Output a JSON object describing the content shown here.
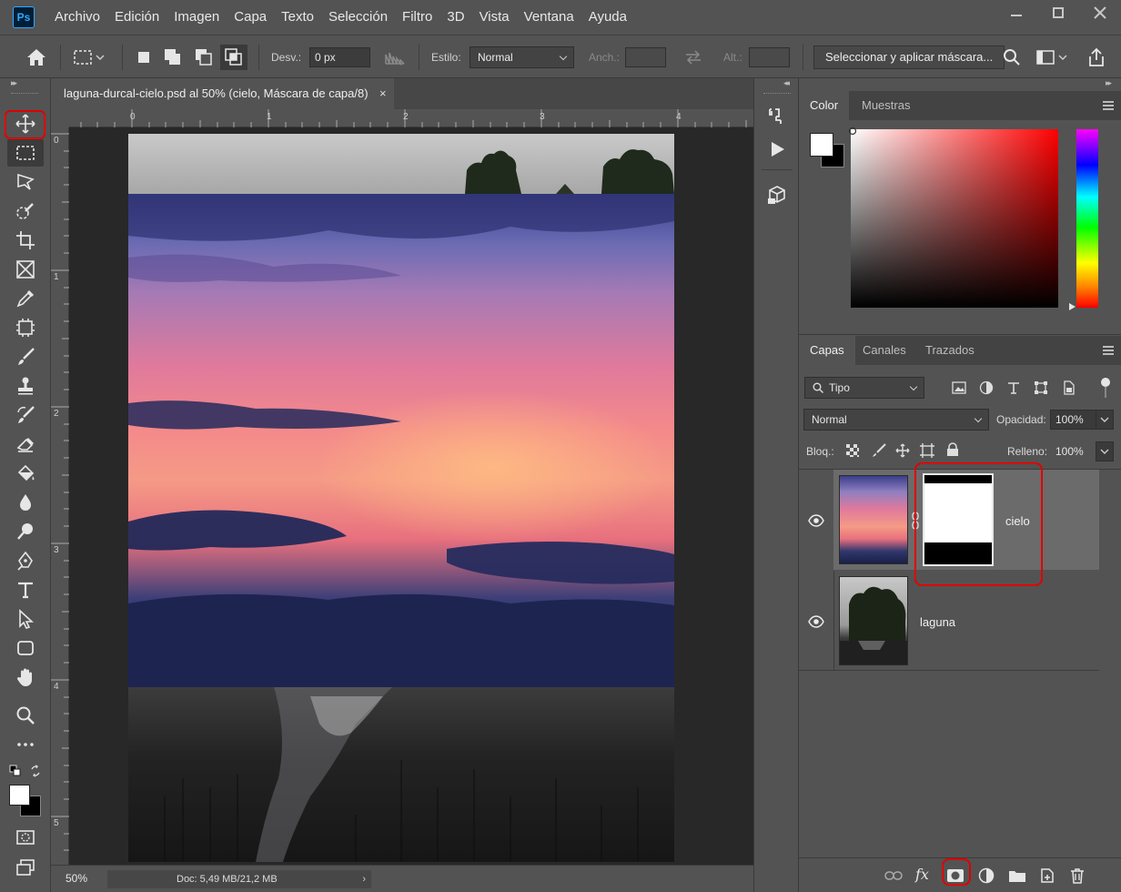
{
  "app": {
    "logo": "Ps"
  },
  "menu": [
    "Archivo",
    "Edición",
    "Imagen",
    "Capa",
    "Texto",
    "Selección",
    "Filtro",
    "3D",
    "Vista",
    "Ventana",
    "Ayuda"
  ],
  "options": {
    "feather_label": "Desv.:",
    "feather_value": "0 px",
    "style_label": "Estilo:",
    "style_value": "Normal",
    "width_label": "Anch.:",
    "height_label": "Alt.:",
    "mask_button": "Seleccionar y aplicar máscara..."
  },
  "document": {
    "tab_title": "laguna-durcal-cielo.psd al 50% (cielo, Máscara de capa/8)",
    "close_glyph": "×",
    "ruler_h": [
      "0",
      "1",
      "2",
      "3",
      "4"
    ],
    "ruler_v": [
      "0",
      "1",
      "2",
      "3",
      "4",
      "5"
    ]
  },
  "status": {
    "zoom": "50%",
    "doc_info": "Doc: 5,49 MB/21,2 MB",
    "arrow": "›"
  },
  "color_panel": {
    "tabs": [
      "Color",
      "Muestras"
    ],
    "foreground": "#ffffff",
    "background": "#000000"
  },
  "layers_panel": {
    "tabs": [
      "Capas",
      "Canales",
      "Trazados"
    ],
    "filter_kind": "Tipo",
    "blend_mode": "Normal",
    "opacity_label": "Opacidad:",
    "opacity_value": "100%",
    "lock_label": "Bloq.:",
    "fill_label": "Relleno:",
    "fill_value": "100%",
    "layers": [
      {
        "name": "cielo",
        "visible": true,
        "has_mask": true,
        "selected": true
      },
      {
        "name": "laguna",
        "visible": true,
        "has_mask": false,
        "selected": false
      }
    ],
    "footer_fx": "fx"
  },
  "highlight_color": "#e00000"
}
